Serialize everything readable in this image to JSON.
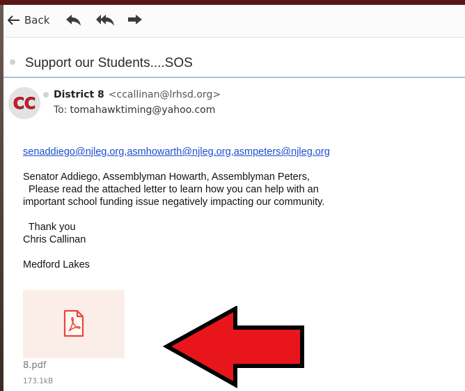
{
  "toolbar": {
    "back_label": "Back",
    "icons": [
      "reply-icon",
      "reply-all-icon",
      "forward-icon"
    ]
  },
  "email": {
    "subject": "Support our Students....SOS",
    "sender_name": "District 8",
    "sender_email": "<ccallinan@lrhsd.org>",
    "to_label": "To:",
    "to_address": "tomahawktiming@yahoo.com",
    "avatar_initials": "CC",
    "recipients": {
      "link1": "senaddiego@njleg.org",
      "sep1": ",",
      "link2": "asmhowarth@njleg.org",
      "sep2": ",",
      "link3": "asmpeters@njleg.org"
    },
    "greeting": "Senator Addiego, Assemblyman Howarth, Assemblyman Peters,",
    "body_line1": "  Please read the attached letter to learn how you can help with an",
    "body_line2": "important school funding issue negatively impacting our community.",
    "closing": "  Thank you",
    "signature": "Chris Callinan",
    "location": "Medford Lakes"
  },
  "attachment": {
    "icon": "pdf-icon",
    "name": "8.pdf",
    "size": "173.1kB"
  },
  "colors": {
    "link": "#1a4fd0",
    "arrow": "#e8161b",
    "frame_top": "#5a1418",
    "avatar_text": "#d81b2b"
  }
}
